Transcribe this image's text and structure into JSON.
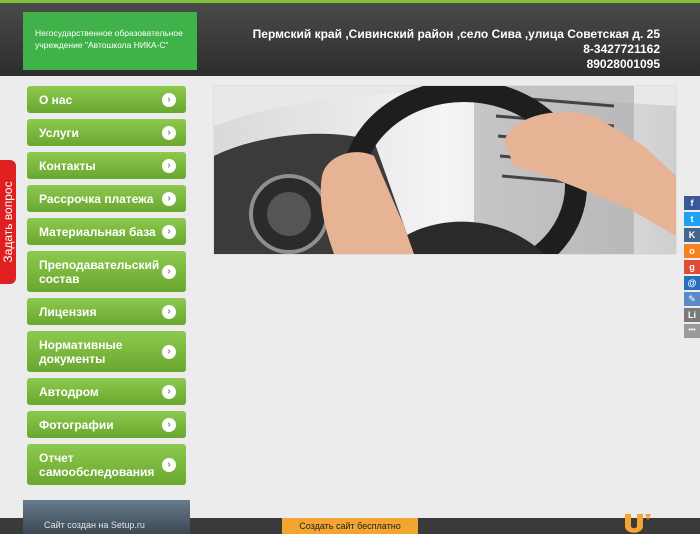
{
  "header": {
    "org_name": "Негосударственное образовательное учреждение \"Автошкола НИКА-С\"",
    "address": "Пермский край  ,Сивинский район ,село Сива ,улица Советская д. 25",
    "phone1": "8-3427721162",
    "phone2": "89028001095"
  },
  "ask_tab": {
    "label": "Задать вопрос"
  },
  "menu": [
    {
      "label": "О нас"
    },
    {
      "label": "Услуги"
    },
    {
      "label": "Контакты"
    },
    {
      "label": "Рассрочка платежа"
    },
    {
      "label": "Материальная база"
    },
    {
      "label": "Преподавательский состав"
    },
    {
      "label": "Лицензия"
    },
    {
      "label": "Нормативные документы"
    },
    {
      "label": "Автодром"
    },
    {
      "label": "Фотографии"
    },
    {
      "label": "Отчет самообследования"
    }
  ],
  "social": [
    {
      "icon": "facebook-icon",
      "glyph": "f",
      "color": "#3b5998"
    },
    {
      "icon": "twitter-icon",
      "glyph": "t",
      "color": "#1da1f2"
    },
    {
      "icon": "vk-icon",
      "glyph": "K",
      "color": "#45668e"
    },
    {
      "icon": "odnoklassniki-icon",
      "glyph": "o",
      "color": "#f58220"
    },
    {
      "icon": "google-plus-icon",
      "glyph": "g",
      "color": "#dd4b39"
    },
    {
      "icon": "mail-icon",
      "glyph": "@",
      "color": "#2a6ebb"
    },
    {
      "icon": "livejournal-icon",
      "glyph": "✎",
      "color": "#5b8ac6"
    },
    {
      "icon": "liveinternet-icon",
      "glyph": "Li",
      "color": "#7a7a7a"
    },
    {
      "icon": "more-icon",
      "glyph": "•••",
      "color": "#9a9a9a"
    }
  ],
  "footer": {
    "setup_text": "Сайт создан на Setup.ru",
    "create_button": "Создать сайт бесплатно"
  }
}
